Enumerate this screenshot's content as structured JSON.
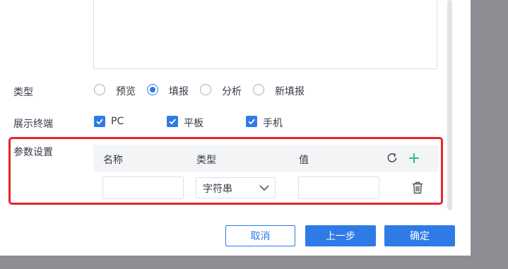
{
  "form": {
    "type_row": {
      "label": "类型",
      "options": [
        {
          "label": "预览",
          "checked": false
        },
        {
          "label": "填报",
          "checked": true
        },
        {
          "label": "分析",
          "checked": false
        },
        {
          "label": "新填报",
          "checked": false
        }
      ]
    },
    "terminal_row": {
      "label": "展示终端",
      "options": [
        {
          "label": "PC",
          "checked": true
        },
        {
          "label": "平板",
          "checked": true
        },
        {
          "label": "手机",
          "checked": true
        }
      ]
    },
    "params_row": {
      "label": "参数设置",
      "columns": [
        "名称",
        "类型",
        "值"
      ],
      "rows": [
        {
          "name": "",
          "type": "字符串",
          "value": ""
        }
      ]
    }
  },
  "footer": {
    "cancel_label": "取消",
    "prev_label": "上一步",
    "confirm_label": "确定"
  },
  "colors": {
    "primary": "#2e7be6",
    "highlight": "#e8252b",
    "add_icon": "#19be6b",
    "overlay": "#8c8e93"
  },
  "icons": {
    "refresh": "refresh-icon",
    "add": "plus-icon",
    "delete": "trash-icon",
    "dropdown": "chevron-down-icon"
  }
}
